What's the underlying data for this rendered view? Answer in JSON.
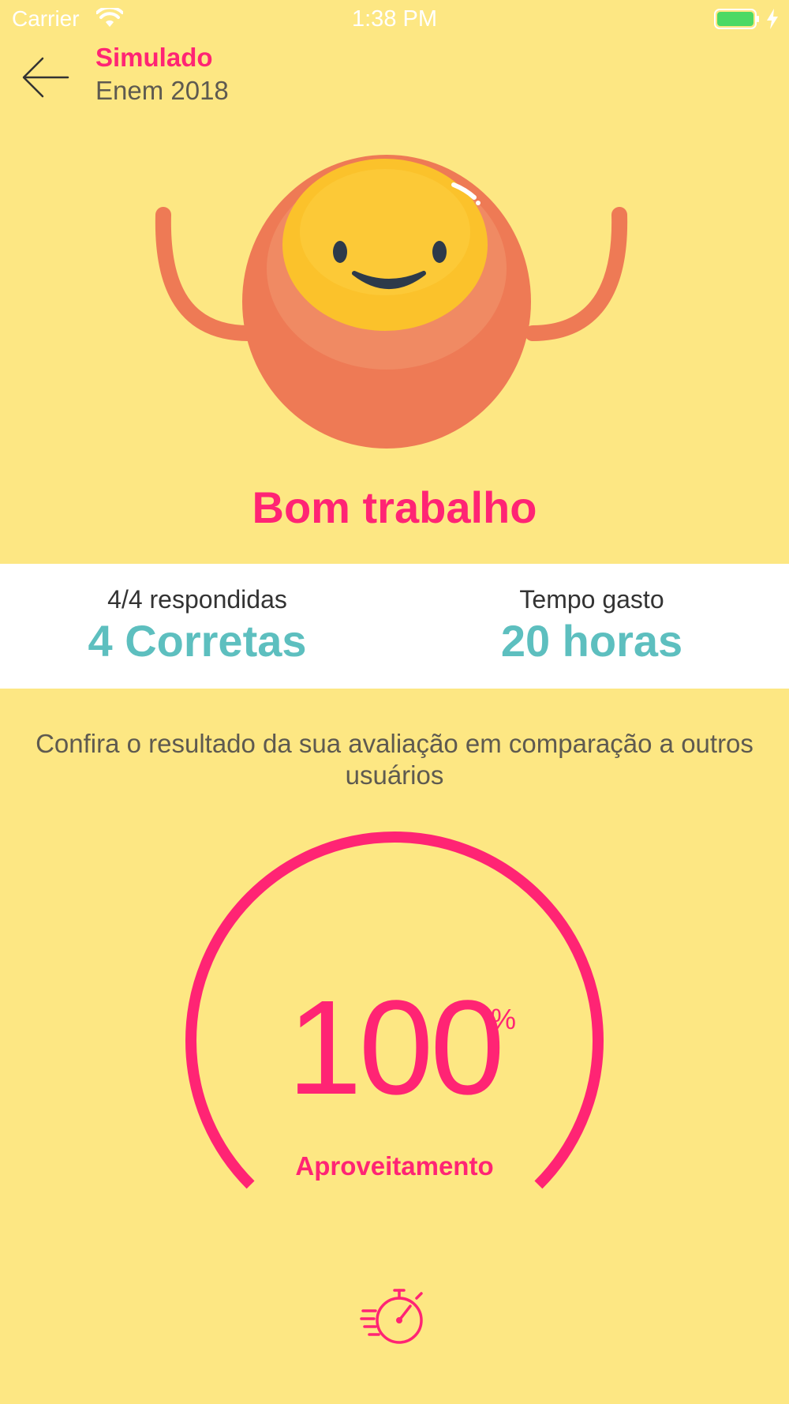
{
  "status_bar": {
    "carrier": "Carrier",
    "time": "1:38 PM",
    "icons": [
      "wifi-icon",
      "battery-icon",
      "charging-icon"
    ]
  },
  "header": {
    "back_icon": "arrow-left-icon",
    "title": "Simulado",
    "subtitle": "Enem 2018"
  },
  "result": {
    "headline": "Bom trabalho",
    "mascot_icon": "happy-ball-mascot"
  },
  "stats": {
    "answered_label": "4/4 respondidas",
    "correct_value": "4 Corretas",
    "time_label": "Tempo gasto",
    "time_value": "20 horas"
  },
  "comparison": {
    "text": "Confira o resultado da sua avaliação em comparação a outros usuários"
  },
  "gauge": {
    "value": "100",
    "unit": "%",
    "label": "Aproveitamento",
    "percent": 100
  },
  "footer": {
    "icon": "stopwatch-icon"
  },
  "colors": {
    "background": "#FDE783",
    "accent": "#FF2474",
    "teal": "#5DBFBF",
    "mascot_body": "#EE7A55",
    "mascot_face": "#FBC22B"
  }
}
